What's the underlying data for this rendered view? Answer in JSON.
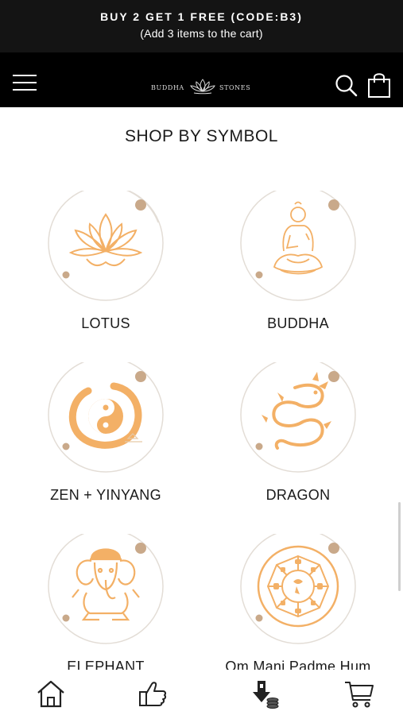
{
  "promo": {
    "line1": "BUY 2 GET 1 FREE (CODE:B3)",
    "line2": "(Add 3 items to the cart)"
  },
  "header": {
    "logo_left": "BUDDHA",
    "logo_right": "STONES",
    "menu_icon": "hamburger-menu-icon",
    "search_icon": "search-icon",
    "bag_icon": "shopping-bag-icon"
  },
  "section": {
    "title": "SHOP BY SYMBOL"
  },
  "symbols": [
    {
      "label": "LOTUS",
      "icon": "lotus-icon"
    },
    {
      "label": "BUDDHA",
      "icon": "buddha-icon"
    },
    {
      "label": "ZEN + YINYANG",
      "icon": "yinyang-icon"
    },
    {
      "label": "DRAGON",
      "icon": "dragon-icon"
    },
    {
      "label": "ELEPHANT",
      "icon": "elephant-icon"
    },
    {
      "label": "Om Mani Padme Hum",
      "icon": "om-mani-padme-hum-icon"
    }
  ],
  "bottom_nav": [
    {
      "icon": "home-icon"
    },
    {
      "icon": "thumbs-up-icon"
    },
    {
      "icon": "download-icon"
    },
    {
      "icon": "cart-icon"
    }
  ],
  "colors": {
    "promo_bg": "#141414",
    "header_bg": "#000000",
    "accent_orange": "#f3b066",
    "accent_dot": "#c9a98a",
    "ring": "#e3ddd6"
  }
}
